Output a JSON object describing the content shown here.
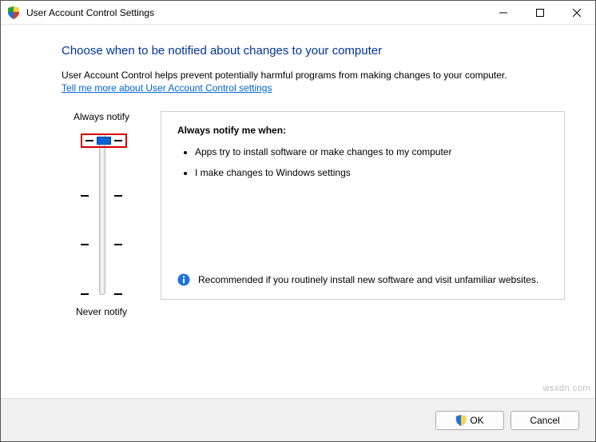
{
  "titlebar": {
    "title": "User Account Control Settings"
  },
  "heading": "Choose when to be notified about changes to your computer",
  "subtext": "User Account Control helps prevent potentially harmful programs from making changes to your computer.",
  "link": "Tell me more about User Account Control settings",
  "slider": {
    "top_label": "Always notify",
    "bottom_label": "Never notify"
  },
  "desc": {
    "title": "Always notify me when:",
    "bullets": [
      "Apps try to install software or make changes to my computer",
      "I make changes to Windows settings"
    ],
    "recommendation": "Recommended if you routinely install new software and visit unfamiliar websites."
  },
  "buttons": {
    "ok": "OK",
    "cancel": "Cancel"
  },
  "watermark": "wsxdn.com"
}
